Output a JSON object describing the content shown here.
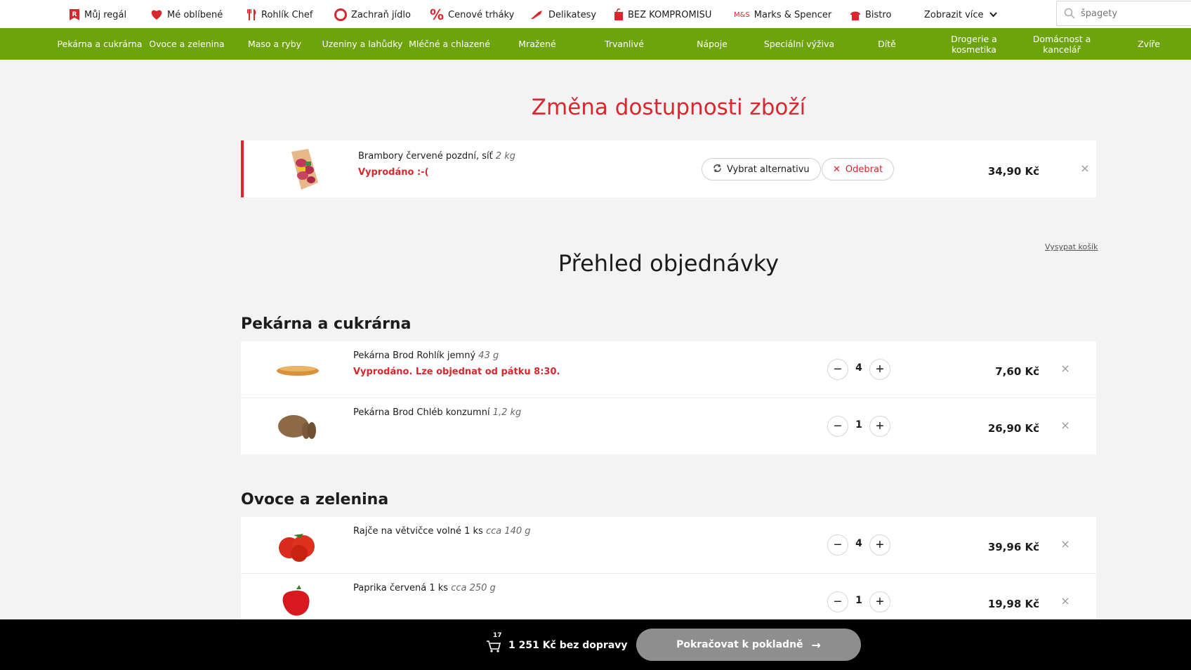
{
  "topnav": {
    "items": [
      {
        "label": "Můj regál",
        "icon": "shelf-icon"
      },
      {
        "label": "Mé oblíbené",
        "icon": "heart-icon"
      },
      {
        "label": "Rohlík Chef",
        "icon": "cutlery-icon"
      },
      {
        "label": "Zachraň jídlo",
        "icon": "lifebuoy-icon"
      },
      {
        "label": "Cenové trháky",
        "icon": "percent-icon"
      },
      {
        "label": "Delikatesy",
        "icon": "knife-icon"
      },
      {
        "label": "BEZ KOMPROMISU",
        "icon": "bag-icon"
      },
      {
        "label": "Marks & Spencer",
        "icon": "ms-logo-icon",
        "badge": "M&S"
      },
      {
        "label": "Bistro",
        "icon": "bistro-icon"
      }
    ],
    "more_label": "Zobrazit více",
    "search_placeholder": "špagety"
  },
  "categories": [
    "Pekárna a cukrárna",
    "Ovoce a zelenina",
    "Maso a ryby",
    "Uzeniny a lahůdky",
    "Mléčné a chlazené",
    "Mražené",
    "Trvanlivé",
    "Nápoje",
    "Speciální výživa",
    "Dítě",
    "Drogerie a kosmetika",
    "Domácnost a kancelář",
    "Zvíře"
  ],
  "availability": {
    "title": "Změna dostupnosti zboží",
    "item": {
      "name": "Brambory červené pozdní, síť",
      "weight": "2 kg",
      "status": "Vyprodáno :-(",
      "alt_label": "Vybrat alternativu",
      "remove_label": "Odebrat",
      "price": "34,90 Kč",
      "close": "×"
    }
  },
  "order": {
    "title": "Přehled objednávky",
    "clear_label": "Vysypat košík",
    "sections": [
      {
        "title": "Pekárna a cukrárna",
        "items": [
          {
            "name": "Pekárna Brod Rohlík jemný",
            "weight": "43 g",
            "status": "Vyprodáno. Lze objednat od pátku 8:30.",
            "qty": "4",
            "price": "7,60 Kč"
          },
          {
            "name": "Pekárna Brod Chléb konzumní",
            "weight": "1,2 kg",
            "status": "",
            "qty": "1",
            "price": "26,90 Kč"
          }
        ]
      },
      {
        "title": "Ovoce a zelenina",
        "items": [
          {
            "name": "Rajče na větvičce volné 1 ks",
            "weight": "cca 140 g",
            "status": "",
            "qty": "4",
            "price": "39,96 Kč"
          },
          {
            "name": "Paprika červená 1 ks",
            "weight": "cca 250 g",
            "status": "",
            "qty": "1",
            "price": "19,98 Kč"
          }
        ]
      }
    ],
    "minus": "−",
    "plus": "+",
    "remove": "×"
  },
  "footer": {
    "cart_count": "17",
    "total": "1 251 Kč bez dopravy",
    "checkout_label": "Pokračovat k pokladně"
  },
  "colors": {
    "brand_red": "#d9272e",
    "brand_green": "#6da40c",
    "checkout_gray": "#8e8e8e"
  }
}
